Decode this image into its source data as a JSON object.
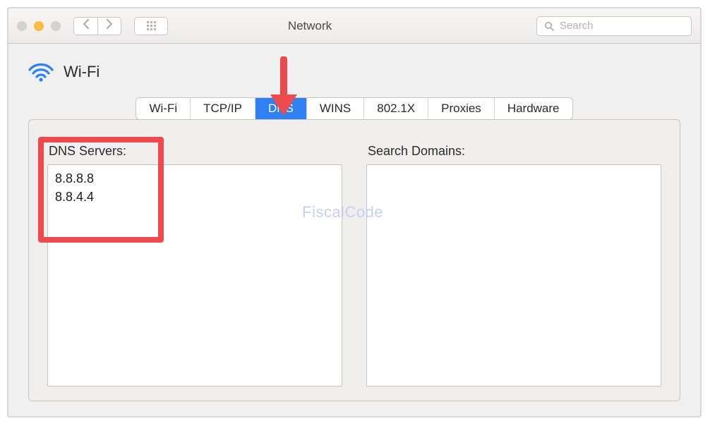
{
  "window": {
    "title": "Network"
  },
  "toolbar": {
    "search_placeholder": "Search"
  },
  "header": {
    "page_title": "Wi-Fi"
  },
  "tabs": [
    {
      "label": "Wi-Fi",
      "active": false
    },
    {
      "label": "TCP/IP",
      "active": false
    },
    {
      "label": "DNS",
      "active": true
    },
    {
      "label": "WINS",
      "active": false
    },
    {
      "label": "802.1X",
      "active": false
    },
    {
      "label": "Proxies",
      "active": false
    },
    {
      "label": "Hardware",
      "active": false
    }
  ],
  "dns": {
    "servers_label": "DNS Servers:",
    "servers": [
      "8.8.8.8",
      "8.8.4.4"
    ],
    "domains_label": "Search Domains:",
    "domains": []
  },
  "watermark": "FiscalCode",
  "annotation": {
    "highlight_color": "#ee4a4e",
    "arrow_color": "#ee4a4e"
  }
}
